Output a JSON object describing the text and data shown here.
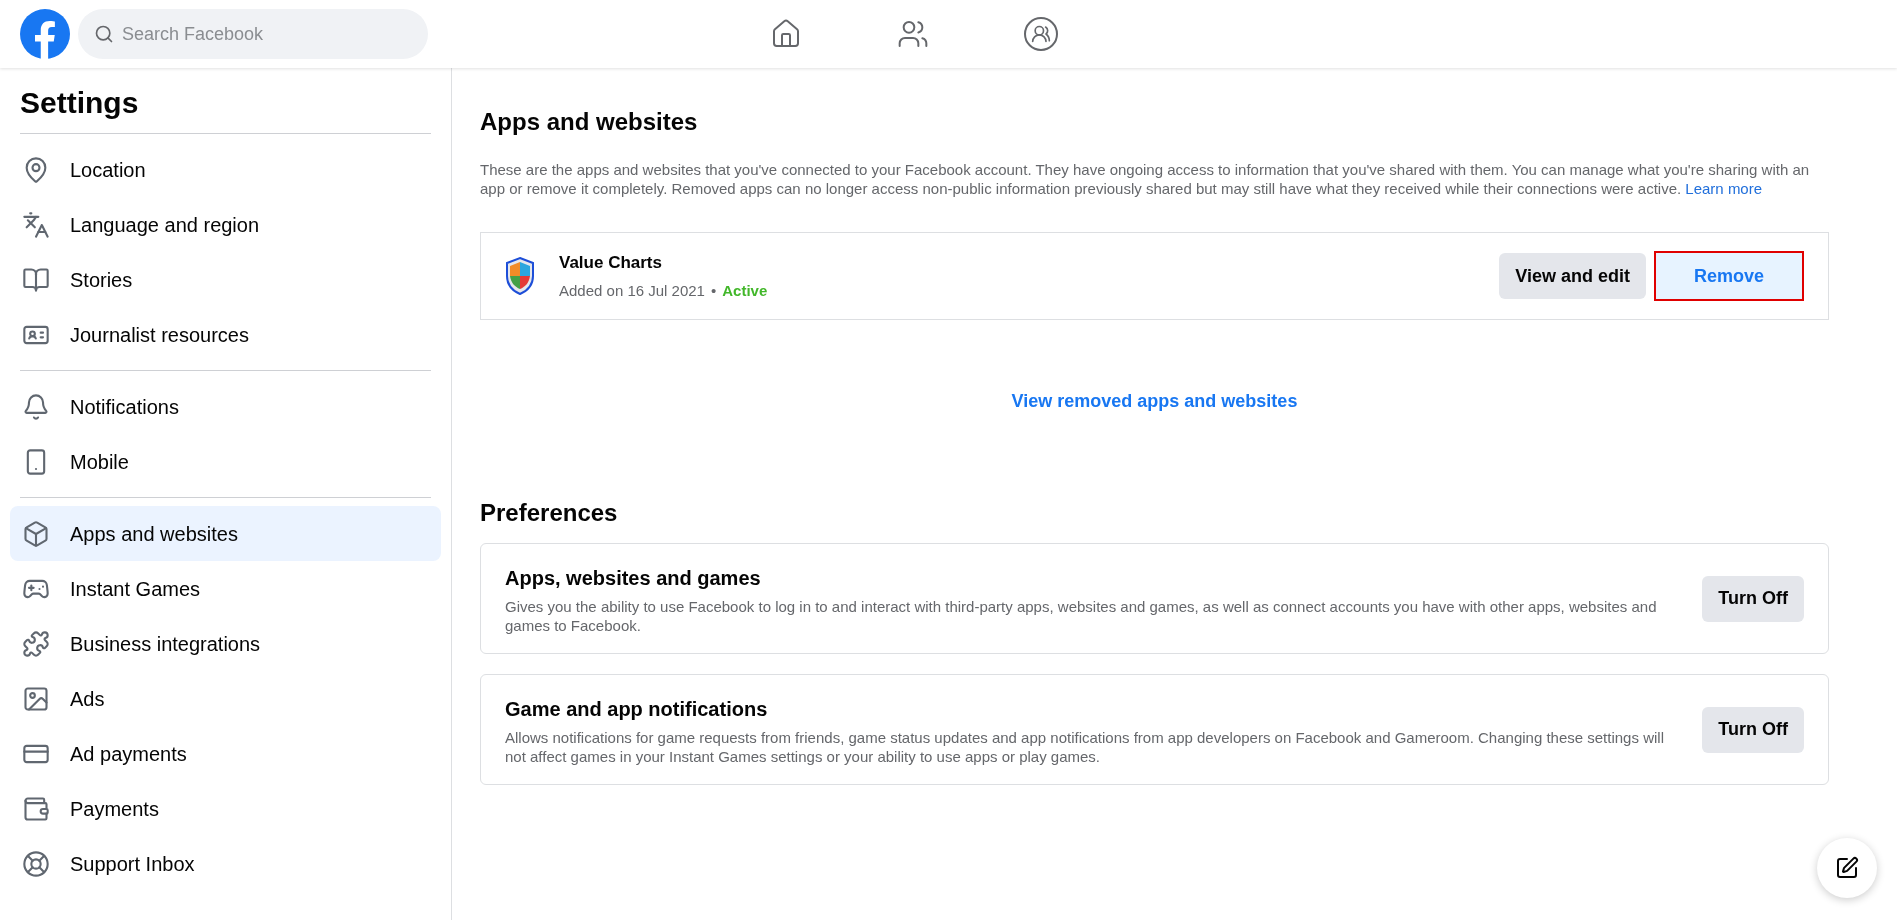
{
  "header": {
    "search": {
      "placeholder": "Search Facebook"
    }
  },
  "sidebar": {
    "title": "Settings",
    "groups": [
      {
        "items": [
          {
            "label": "Location",
            "selected": false
          },
          {
            "label": "Language and region",
            "selected": false
          },
          {
            "label": "Stories",
            "selected": false
          },
          {
            "label": "Journalist resources",
            "selected": false
          }
        ]
      },
      {
        "items": [
          {
            "label": "Notifications",
            "selected": false
          },
          {
            "label": "Mobile",
            "selected": false
          }
        ]
      },
      {
        "items": [
          {
            "label": "Apps and websites",
            "selected": true
          },
          {
            "label": "Instant Games",
            "selected": false
          },
          {
            "label": "Business integrations",
            "selected": false
          },
          {
            "label": "Ads",
            "selected": false
          },
          {
            "label": "Ad payments",
            "selected": false
          },
          {
            "label": "Payments",
            "selected": false
          },
          {
            "label": "Support Inbox",
            "selected": false
          }
        ]
      }
    ]
  },
  "main": {
    "title": "Apps and websites",
    "description": "These are the apps and websites that you've connected to your Facebook account. They have ongoing access to information that you've shared with them. You can manage what you're sharing with an app or remove it completely. Removed apps can no longer access non-public information previously shared but may still have what they received while their connections were active.",
    "learn_more": "Learn more",
    "apps": [
      {
        "name": "Value Charts",
        "added": "Added on 16 Jul 2021",
        "separator": "•",
        "status": "Active",
        "view_button": "View and edit",
        "remove_button": "Remove",
        "remove_outlined": true
      }
    ],
    "view_removed": "View removed apps and websites",
    "preferences_title": "Preferences",
    "preferences": [
      {
        "title": "Apps, websites and games",
        "description": "Gives you the ability to use Facebook to log in to and interact with third-party apps, websites and games, as well as connect accounts you have with other apps, websites and games to Facebook.",
        "button": "Turn Off"
      },
      {
        "title": "Game and app notifications",
        "description": "Allows notifications for game requests from friends, game status updates and app notifications from app developers on Facebook and Gameroom. Changing these settings will not affect games in your Instant Games settings or your ability to use apps or play games.",
        "button": "Turn Off"
      }
    ]
  }
}
